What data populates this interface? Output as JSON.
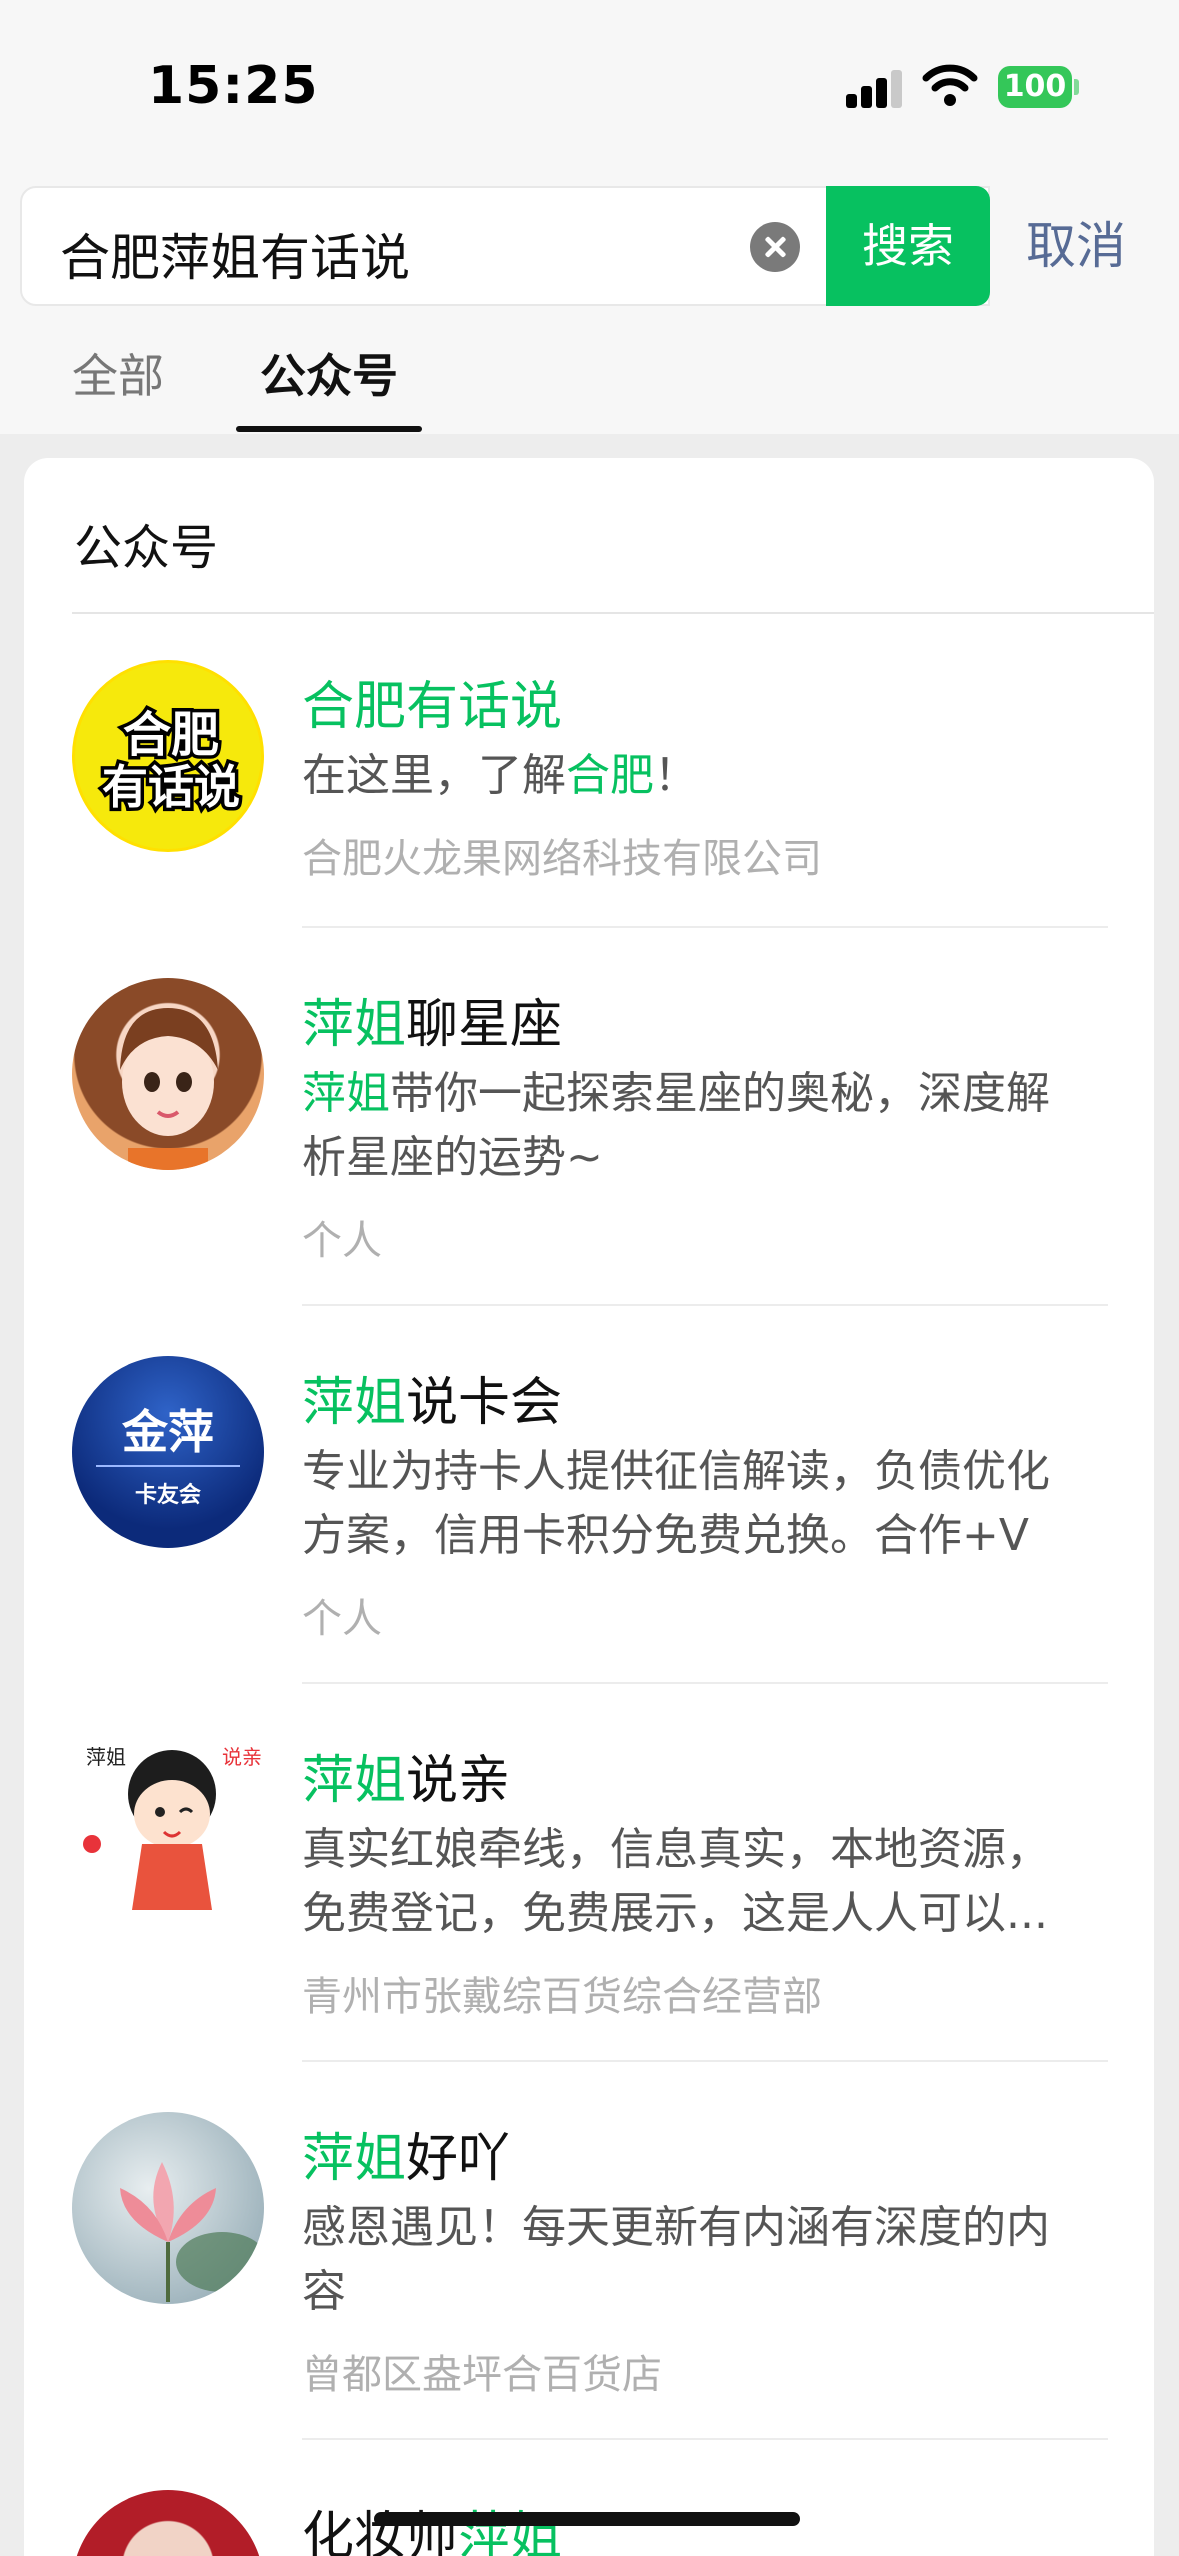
{
  "status_bar": {
    "time": "15:25",
    "battery": "100"
  },
  "search": {
    "query": "合肥萍姐有话说",
    "button_label": "搜索",
    "cancel_label": "取消"
  },
  "tabs": [
    {
      "label": "全部",
      "active": false
    },
    {
      "label": "公众号",
      "active": true
    }
  ],
  "section": {
    "title": "公众号"
  },
  "results": [
    {
      "name_pre": "",
      "name_hl": "合肥有话说",
      "name_post": "",
      "desc_lines": [
        {
          "pre": "在这里，了解",
          "hl": "合肥",
          "post": "！"
        }
      ],
      "sub": "合肥火龙果网络科技有限公司",
      "avatar_icon": "hefei-youhuashuo-logo",
      "avatar_text_1": "合肥",
      "avatar_text_2": "有话说"
    },
    {
      "name_pre": "",
      "name_hl": "萍姐",
      "name_post": "聊星座",
      "desc_lines": [
        {
          "pre": "",
          "hl": "萍姐",
          "post": "带你一起探索星座的奥秘，深度解"
        },
        {
          "pre": "析星座的运势~",
          "hl": "",
          "post": ""
        }
      ],
      "sub": "个人",
      "avatar_icon": "cartoon-girl-avatar"
    },
    {
      "name_pre": "",
      "name_hl": "萍姐",
      "name_post": "说卡会",
      "desc_lines": [
        {
          "pre": "专业为持卡人提供征信解读，负债优化",
          "hl": "",
          "post": ""
        },
        {
          "pre": "方案，信用卡积分免费兑换。合作+V",
          "hl": "",
          "post": ""
        }
      ],
      "sub": "个人",
      "avatar_icon": "jinping-card-logo",
      "avatar_text_1": "金萍",
      "avatar_text_2": "卡友会"
    },
    {
      "name_pre": "",
      "name_hl": "萍姐",
      "name_post": "说亲",
      "desc_lines": [
        {
          "pre": "真实红娘牵线，信息真实，本地资源，",
          "hl": "",
          "post": ""
        },
        {
          "pre": "免费登记，免费展示，这是人人可以...",
          "hl": "",
          "post": ""
        }
      ],
      "sub": "青州市张戴综百货综合经营部",
      "avatar_icon": "matchmaker-cartoon-avatar",
      "avatar_text_1": "萍姐",
      "avatar_text_2": "说亲"
    },
    {
      "name_pre": "",
      "name_hl": "萍姐",
      "name_post": "好吖",
      "desc_lines": [
        {
          "pre": "感恩遇见！每天更新有内涵有深度的内",
          "hl": "",
          "post": ""
        },
        {
          "pre": "容",
          "hl": "",
          "post": ""
        }
      ],
      "sub": "曾都区盎坪合百货店",
      "avatar_icon": "lotus-flower-avatar"
    },
    {
      "name_pre": "化妆师",
      "name_hl": "萍姐",
      "name_post": "",
      "desc_lines": [],
      "sub": "",
      "avatar_icon": "woman-portrait-avatar"
    }
  ],
  "colors": {
    "accent": "#07c160",
    "link": "#576b95"
  }
}
